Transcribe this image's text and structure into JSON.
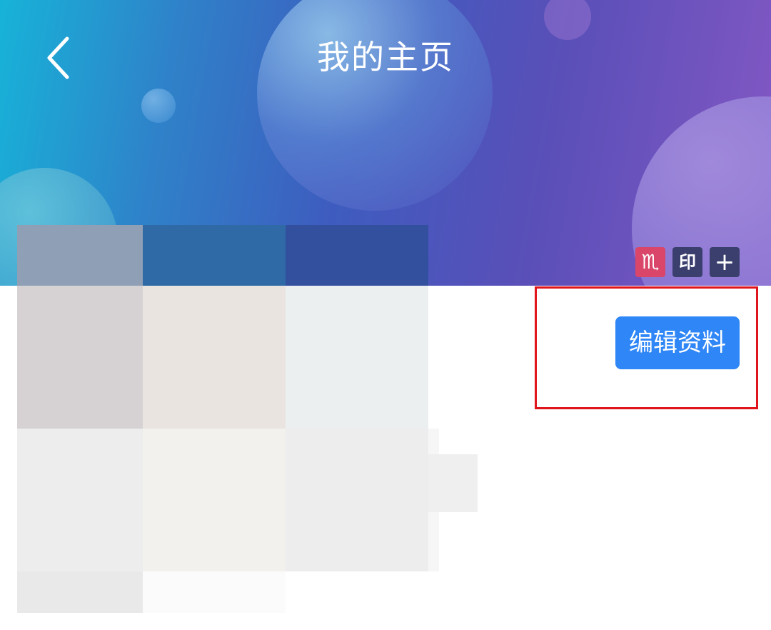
{
  "header": {
    "title": "我的主页",
    "back_icon": "chevron-left-icon",
    "background_colors": [
      "#17b3d8",
      "#3e5cbf",
      "#8458c4"
    ]
  },
  "badges": [
    {
      "name": "zodiac-scorpio-badge",
      "glyph": "♏",
      "color": "#d9466a"
    },
    {
      "name": "seal-badge",
      "glyph": "印",
      "color": "#3a3f6e"
    },
    {
      "name": "add-badge",
      "glyph": "+",
      "color": "#3a3f6e"
    }
  ],
  "profile": {
    "edit_label": "编辑资料",
    "edit_color": "#2f86f6",
    "highlight_color": "#e0141b"
  }
}
